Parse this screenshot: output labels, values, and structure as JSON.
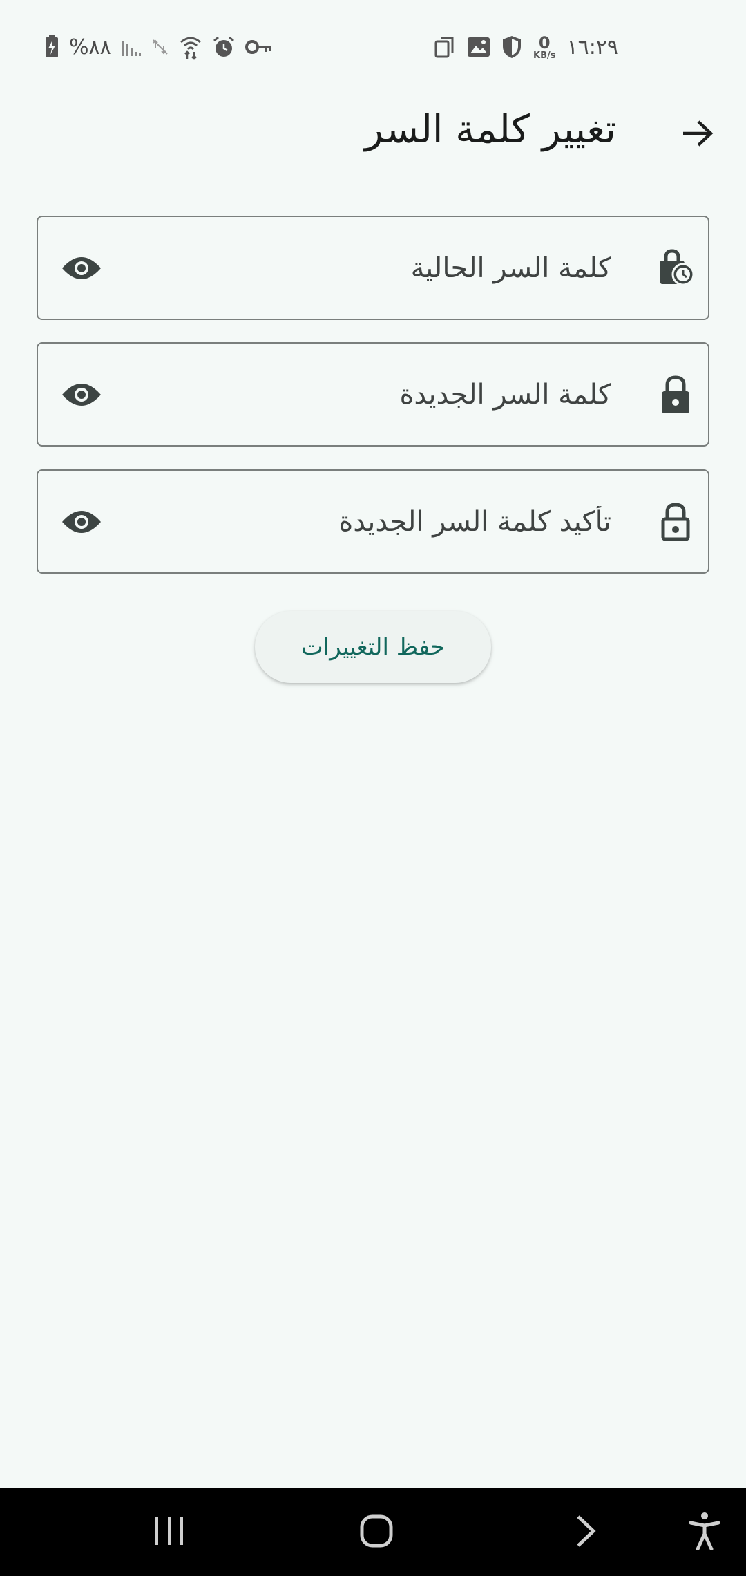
{
  "status_bar": {
    "time": "١٦:٢٩",
    "network_speed_value": "0",
    "network_speed_unit": "KB/s",
    "battery_percent": "%٨٨",
    "icons_right": [
      "copy-icon",
      "image-icon",
      "shield-icon"
    ],
    "icons_left": [
      "battery-charging-icon",
      "signal-icon",
      "data-off-icon",
      "wifi-icon",
      "alarm-icon",
      "vpn-key-icon"
    ]
  },
  "header": {
    "title": "تغيير كلمة السر",
    "back_icon": "arrow-right-icon"
  },
  "form": {
    "current_password": {
      "placeholder": "كلمة السر الحالية",
      "value": "",
      "icon": "lock-clock-icon"
    },
    "new_password": {
      "placeholder": "كلمة السر الجديدة",
      "value": "",
      "icon": "lock-icon"
    },
    "confirm_password": {
      "placeholder": "تأكيد كلمة السر الجديدة",
      "value": "",
      "icon": "lock-outline-icon"
    },
    "visibility_icon": "eye-icon"
  },
  "save_button": {
    "label": "حفظ التغييرات"
  },
  "nav_bar": {
    "items": [
      "recent-apps-icon",
      "home-icon",
      "back-icon",
      "accessibility-icon"
    ]
  },
  "colors": {
    "background": "#f4f9f7",
    "accent": "#11675c",
    "field_border": "#7a7f7d",
    "icon": "#3d4543"
  }
}
